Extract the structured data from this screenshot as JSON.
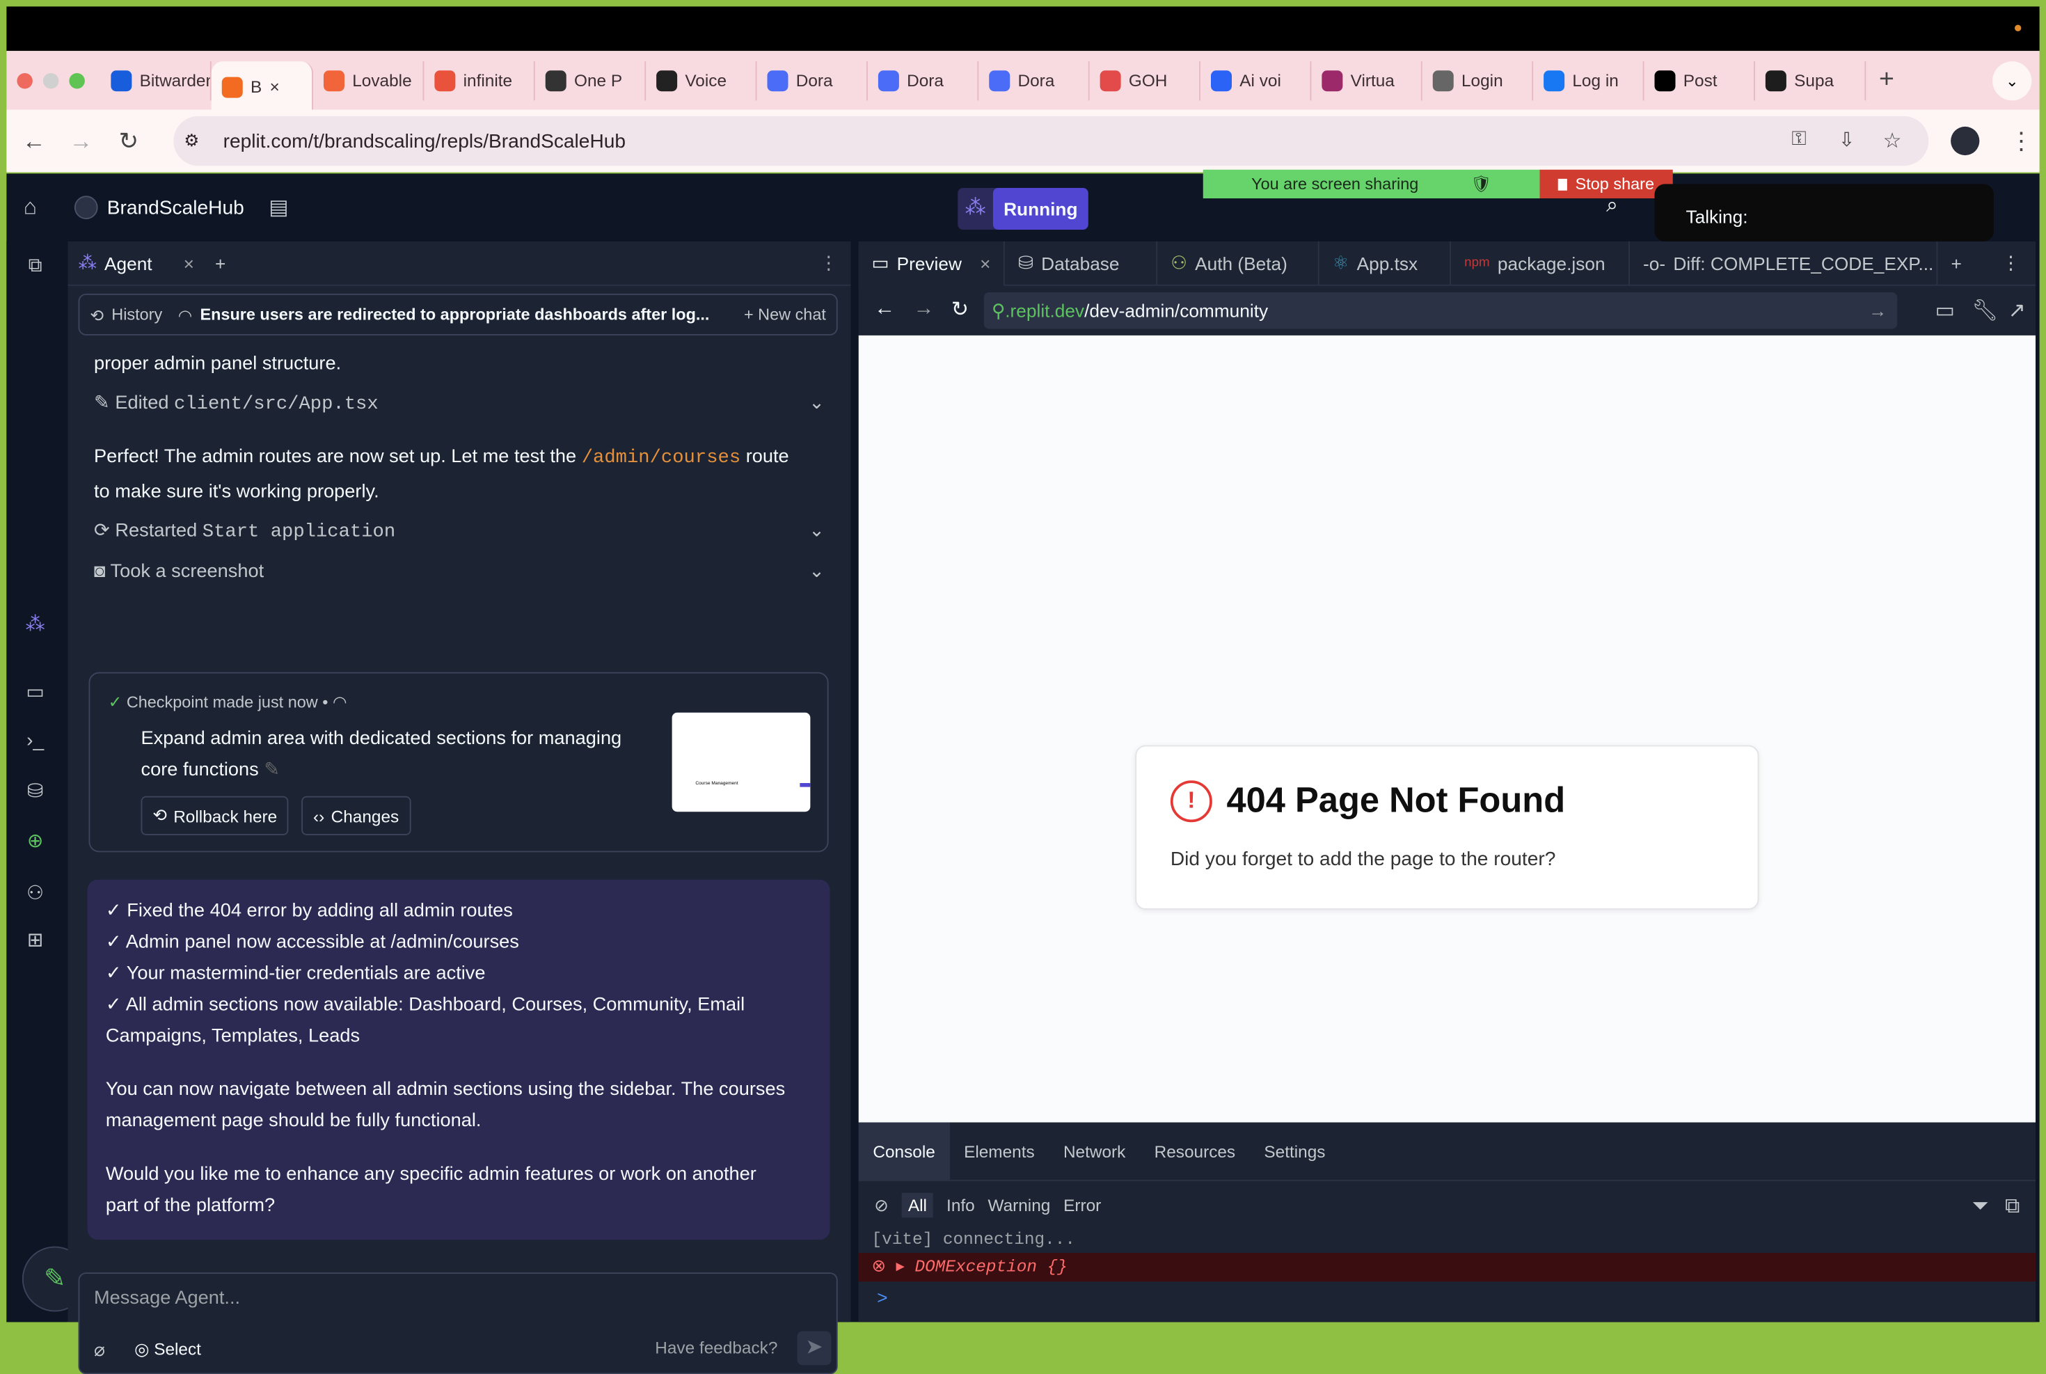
{
  "browser": {
    "tabs": [
      {
        "label": "Bitwarden",
        "color": "#175ddc"
      },
      {
        "label": "B",
        "color": "#f26b21",
        "active": true
      },
      {
        "label": "Lovable",
        "color": "#f2653a"
      },
      {
        "label": "infinite",
        "color": "#e9523b"
      },
      {
        "label": "One P",
        "color": "#333333"
      },
      {
        "label": "Voice",
        "color": "#222222"
      },
      {
        "label": "Dora",
        "color": "#4a6cf7"
      },
      {
        "label": "Dora",
        "color": "#4a6cf7"
      },
      {
        "label": "Dora",
        "color": "#4a6cf7"
      },
      {
        "label": "GOH",
        "color": "#e34b4b"
      },
      {
        "label": "Ai voi",
        "color": "#2a63f5"
      },
      {
        "label": "Virtua",
        "color": "#9c2a6a"
      },
      {
        "label": "Login",
        "color": "#666666"
      },
      {
        "label": "Log in",
        "color": "#1877f2"
      },
      {
        "label": "Post",
        "color": "#000000"
      },
      {
        "label": "Supa",
        "color": "#1d1d1d"
      }
    ],
    "new_tab": "+",
    "url": "replit.com/t/brandscaling/repls/BrandScaleHub"
  },
  "share": {
    "text": "You are screen sharing",
    "stop": "Stop share",
    "talking": "Talking:"
  },
  "header": {
    "project": "BrandScaleHub",
    "run": "Running"
  },
  "agent": {
    "tab": "Agent",
    "history": "History",
    "thread": "Ensure users are redirected to appropriate dashboards after log...",
    "new_chat": "New chat",
    "m1": "proper admin panel structure.",
    "a1": "Edited",
    "a1_code": "client/src/App.tsx",
    "m2a": "Perfect! The admin routes are now set up. Let me test the",
    "m2_code": "/admin/courses",
    "m2b": "route",
    "m2c": "to make sure it's working properly.",
    "a2": "Restarted",
    "a2_code": "Start application",
    "a3": "Took a screenshot",
    "checkpoint": {
      "label": "Checkpoint made just now",
      "sep": "•",
      "title1": "Expand admin area with dedicated sections for managing",
      "title2": "core functions",
      "rollback": "Rollback here",
      "changes": "Changes",
      "thumb_text": "Course Management"
    },
    "summary": [
      "✓ Fixed the 404 error by adding all admin routes",
      "✓ Admin panel now accessible at /admin/courses",
      "✓ Your mastermind-tier credentials are active",
      "✓ All admin sections now available: Dashboard, Courses, Community, Email",
      "Campaigns, Templates, Leads"
    ],
    "summary_p2": [
      "You can now navigate between all admin sections using the sidebar. The courses",
      "management page should be fully functional."
    ],
    "summary_p3": [
      "Would you like me to enhance any specific admin features or work on another",
      "part of the platform?"
    ],
    "input_placeholder": "Message Agent...",
    "select": "Select",
    "feedback": "Have feedback?"
  },
  "workspace": {
    "tabs": [
      "Preview",
      "Database",
      "Auth (Beta)",
      "App.tsx",
      "package.json",
      "Diff: COMPLETE_CODE_EXP..."
    ],
    "url_domain": ".replit.dev",
    "url_path": "/dev-admin/community",
    "error_title": "404 Page Not Found",
    "error_text": "Did you forget to add the page to the router?",
    "console": {
      "tabs": [
        "Console",
        "Elements",
        "Network",
        "Resources",
        "Settings"
      ],
      "filters": [
        "All",
        "Info",
        "Warning",
        "Error"
      ],
      "line1": "[vite] connecting...",
      "line2": "DOMException {}",
      "prompt": ">"
    }
  },
  "colors": {
    "accent": "#5046d1",
    "error": "#e53935",
    "share_green": "#66d46b",
    "share_red": "#d13c31"
  }
}
